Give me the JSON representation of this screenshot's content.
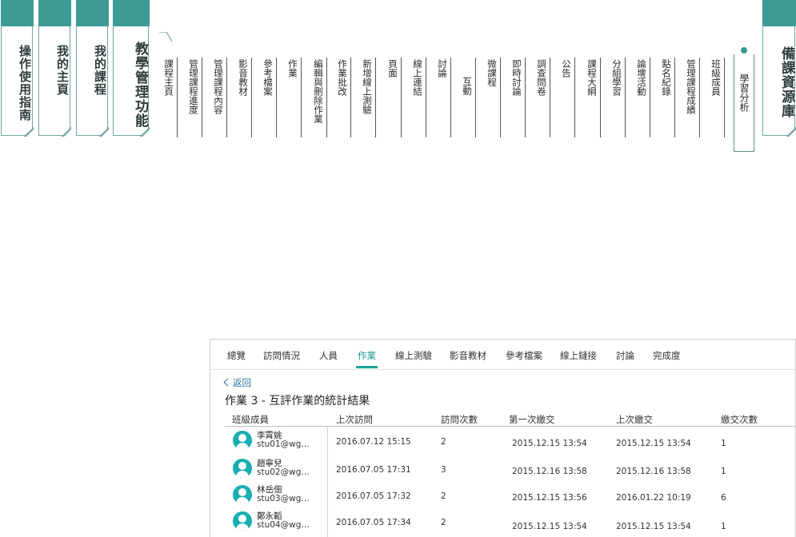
{
  "main_tabs": [
    {
      "label": "操作使用指南"
    },
    {
      "label": "我的主頁"
    },
    {
      "label": "我的課程"
    },
    {
      "label": "教學管理功能"
    },
    {
      "label": "備課資源庫"
    }
  ],
  "sub_menu": [
    "課程主頁",
    "管理課程進度",
    "管理課程內容",
    "影音教材",
    "參考檔案",
    "作業",
    "編輯與刪除作業",
    "作業批改",
    "新增線上測驗",
    "頁面",
    "線上連結",
    "討論",
    "互動",
    "微課程",
    "即時討論",
    "調查問卷",
    "公告",
    "課程大綱",
    "分組學習",
    "論壇活動",
    "點名紀錄",
    "管理課程成績",
    "班級成員",
    "學習分析"
  ],
  "panel": {
    "tabs": [
      "總覽",
      "訪問情況",
      "人員",
      "作業",
      "線上測驗",
      "影音教材",
      "參考檔案",
      "線上鏈接",
      "討論",
      "完成度"
    ],
    "active_tab": "作業",
    "back": "返回",
    "title": "作業 3 - 互評作業的統計結果",
    "columns": [
      "班級成員",
      "上次訪問",
      "訪問次數",
      "第一次繳交",
      "上次繳交",
      "繳交次數"
    ],
    "rows": [
      {
        "name": "李霄姚",
        "email": "stu01@wg…",
        "last_visit": "2016.07.12 15:15",
        "visits": "2",
        "first_submit": "2015.12.15 13:54",
        "last_submit": "2015.12.15 13:54",
        "submits": "1"
      },
      {
        "name": "趙寧兒",
        "email": "stu02@wg…",
        "last_visit": "2016.07.05 17:31",
        "visits": "3",
        "first_submit": "2015.12.16 13:58",
        "last_submit": "2015.12.16 13:58",
        "submits": "1"
      },
      {
        "name": "林岳佃",
        "email": "stu03@wg…",
        "last_visit": "2016.07.05 17:32",
        "visits": "2",
        "first_submit": "2015.12.15 13:56",
        "last_submit": "2016.01.22 10:19",
        "submits": "6"
      },
      {
        "name": "鄭永韜",
        "email": "stu04@wg…",
        "last_visit": "2016.07.05 17:34",
        "visits": "2",
        "first_submit": "2015.12.15 13:54",
        "last_submit": "2015.12.15 13:54",
        "submits": "1"
      }
    ]
  }
}
